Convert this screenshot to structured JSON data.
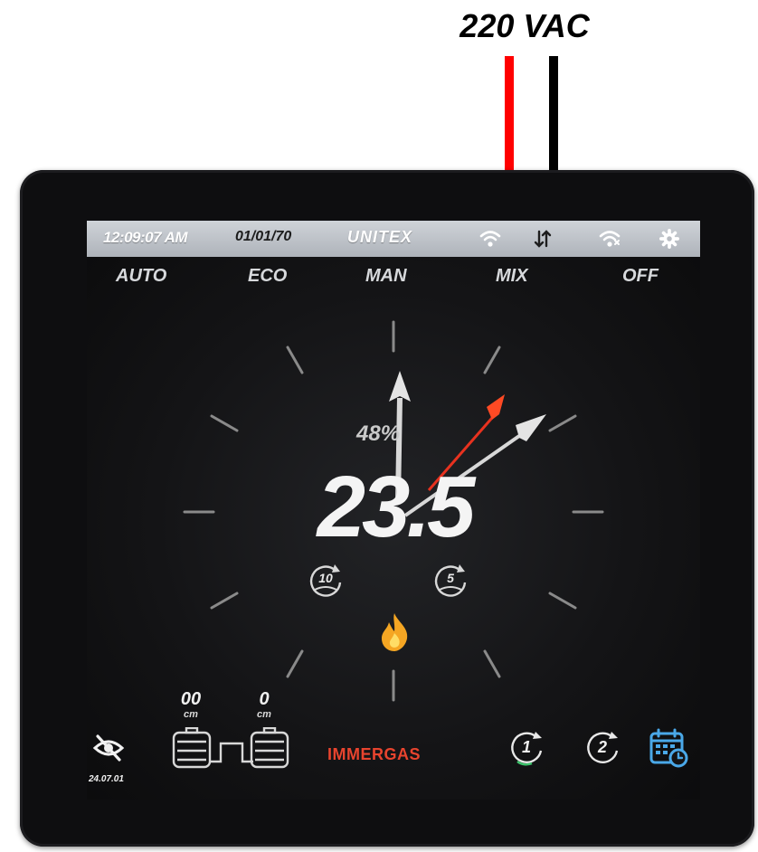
{
  "wiring": {
    "label": "220 VAC"
  },
  "topbar": {
    "time": "12:09:07 AM",
    "date": "01/01/70",
    "brand": "UNITEX",
    "icons": [
      "wifi-icon",
      "transfer-arrows-icon",
      "wifi-alert-icon",
      "gear-icon"
    ]
  },
  "modes": [
    "AUTO",
    "ECO",
    "MAN",
    "MIX",
    "OFF"
  ],
  "gauge": {
    "humidity": "48%",
    "temperature": "23.5",
    "timers": [
      "10",
      "5"
    ],
    "status_icon": "flame-icon"
  },
  "footer": {
    "visibility_date": "24.07.01",
    "tanks": [
      {
        "value": "00",
        "unit": "cm"
      },
      {
        "value": "0",
        "unit": "cm"
      }
    ],
    "brand": "IMMERGAS",
    "schedules": [
      "1",
      "2"
    ],
    "calendar_icon": "calendar-clock-icon"
  },
  "colors": {
    "topbar": "#b8bcc2",
    "red_wire": "#ff0000",
    "black_wire": "#000000",
    "needle_red": "#e8321f",
    "flame": "#f5a623",
    "immergas": "#e8442e",
    "calendar": "#4aa8e8"
  }
}
